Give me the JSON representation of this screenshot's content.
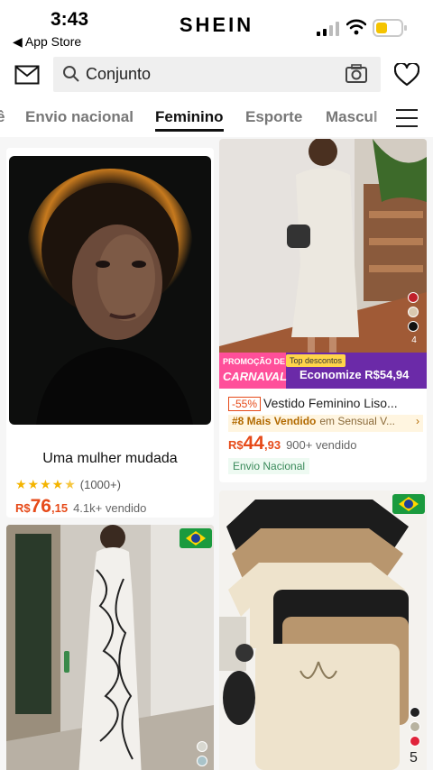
{
  "status_bar": {
    "time": "3:43",
    "back_label": "◀ App Store",
    "brand": "SHEIN",
    "battery_level": 0.45
  },
  "search": {
    "value": "Conjunto"
  },
  "tabs": [
    {
      "label": "ê"
    },
    {
      "label": "Envio nacional"
    },
    {
      "label": "Feminino",
      "active": true
    },
    {
      "label": "Esporte"
    },
    {
      "label": "Mascul"
    }
  ],
  "products": [
    {
      "title": "Uma mulher mudada",
      "rating_stars": 4.5,
      "rating_count": "(1000+)",
      "price_currency": "R$",
      "price_int": "76",
      "price_dec": ",15",
      "sold": "4.1k+ vendido"
    },
    {
      "promo_line1": "PROMOÇÃO DE",
      "promo_line2": "CARNAVAL",
      "promo_tag": "Top descontos",
      "promo_save": "Economize R$54,94",
      "discount": "-55%",
      "title": "Vestido Feminino Liso...",
      "rank": "#8 Mais Vendido",
      "rank_category": "em Sensual V...",
      "price_currency": "R$",
      "price_int": "44",
      "price_dec": ",93",
      "sold": "900+ vendido",
      "shipping": "Envio Nacional",
      "color_count": "4",
      "swatches": [
        "#c0202a",
        "#d9c8b0",
        "#111111"
      ]
    },
    {
      "swatches": [
        "#d8d8d0",
        "#a9c3c9"
      ]
    },
    {
      "color_count": "5",
      "swatches": [
        "#222222",
        "#b8b3a0",
        "#e0233a"
      ]
    }
  ],
  "colors": {
    "price": "#e64a19",
    "promo_bg": "#6b2aa8",
    "promo_pink": "#ff4f9a",
    "rating": "#f4b400",
    "battery": "#f5c400"
  }
}
